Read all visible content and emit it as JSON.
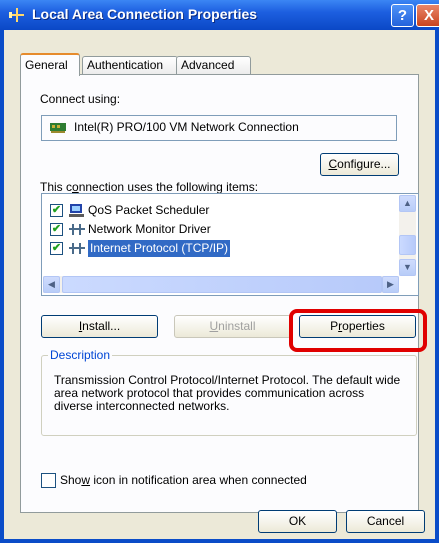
{
  "window": {
    "title": "Local Area Connection Properties",
    "help_glyph": "?",
    "close_glyph": "X"
  },
  "tabs": [
    {
      "label": "General",
      "active": true
    },
    {
      "label": "Authentication",
      "active": false
    },
    {
      "label": "Advanced",
      "active": false
    }
  ],
  "general": {
    "connect_using_label": "Connect using:",
    "adapter_name": "Intel(R) PRO/100 VM Network Connection",
    "adapter_icon": "network-adapter-icon",
    "configure_button": {
      "pre": "",
      "key": "C",
      "post": "onfigure..."
    },
    "items_label": {
      "pre": "This c",
      "key": "o",
      "post": "nnection uses the following items:"
    },
    "items": [
      {
        "label": "QoS Packet Scheduler",
        "checked": true,
        "icon": "scheduler-icon",
        "selected": false
      },
      {
        "label": "Network Monitor Driver",
        "checked": true,
        "icon": "protocol-icon",
        "selected": false
      },
      {
        "label": "Internet Protocol (TCP/IP)",
        "checked": true,
        "icon": "protocol-icon",
        "selected": true
      }
    ],
    "install_button": {
      "pre": "",
      "key": "I",
      "post": "nstall..."
    },
    "uninstall_button": {
      "pre": "",
      "key": "U",
      "post": "ninstall"
    },
    "properties_button": {
      "pre": "P",
      "key": "r",
      "post": "operties"
    },
    "description_title": "Description",
    "description_text": "Transmission Control Protocol/Internet Protocol. The default wide area network protocol that provides communication across diverse interconnected networks.",
    "show_icon_label": {
      "pre": "Sho",
      "key": "w",
      "post": " icon in notification area when connected"
    },
    "show_icon_checked": false
  },
  "footer": {
    "ok_label": "OK",
    "cancel_label": "Cancel"
  },
  "colors": {
    "title_bar": "#1d5fe0",
    "selection": "#316ac5",
    "highlight_annotation": "#e00000"
  }
}
